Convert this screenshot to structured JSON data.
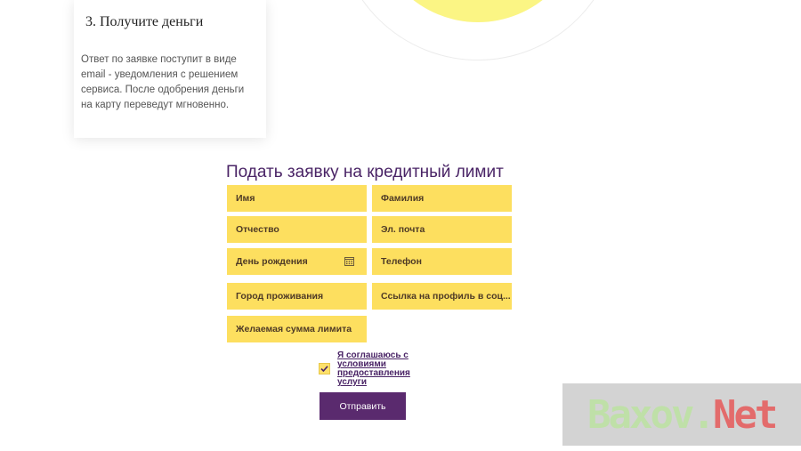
{
  "step": {
    "title": "3. Получите деньги",
    "text": "Ответ по заявке поступит в виде email - уведомления с решением сервиса. После одобрения деньги на карту переведут мгновенно."
  },
  "form": {
    "title": "Подать заявку на кредитный лимит",
    "fields": {
      "first_name": "Имя",
      "last_name": "Фамилия",
      "patronymic": "Отчество",
      "email": "Эл. почта",
      "birthday": "День рождения",
      "phone": "Телефон",
      "city": "Город проживания",
      "social_link": "Ссылка на профиль в соц...",
      "limit_amount": "Желаемая сумма лимита"
    },
    "consent_label": "Я соглашаюсь с условиями предоставления услуги",
    "consent_checked": true,
    "submit_label": "Отправить"
  },
  "colors": {
    "field_bg": "#fddf5f",
    "accent_purple": "#5a2a6e",
    "circle_yellow": "#fbf584"
  },
  "watermark": {
    "part1": "Baxov.",
    "part2": "Net"
  }
}
